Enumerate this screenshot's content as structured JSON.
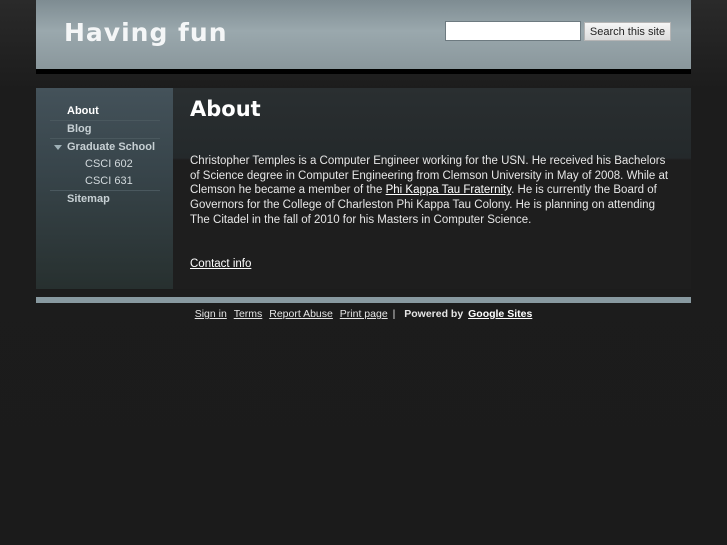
{
  "site": {
    "title": "Having fun"
  },
  "search": {
    "placeholder": "",
    "button_label": "Search this site"
  },
  "sidebar": {
    "items": [
      {
        "label": "About"
      },
      {
        "label": "Blog"
      },
      {
        "label": "Graduate School"
      },
      {
        "label": "CSCI 602"
      },
      {
        "label": "CSCI 631"
      },
      {
        "label": "Sitemap"
      }
    ]
  },
  "main": {
    "title": "About",
    "paragraph_part1": "Christopher Temples is a Computer Engineer working for the USN.   He received his Bachelors of Science degree in Computer Engineering from Clemson University in May of 2008.  While at Clemson he became a member of the ",
    "link_text": "Phi Kappa Tau Fraternity",
    "paragraph_part2": ".  He is currently the Board of Governors for the College of Charleston Phi Kappa Tau Colony.  He is planning on  attending The Citadel in the fall of 2010 for his Masters in Computer Science.",
    "contact_link": "Contact info"
  },
  "footer": {
    "sign_in": "Sign in",
    "terms": "Terms",
    "report_abuse": "Report Abuse",
    "print_page": "Print page",
    "separator": "|",
    "powered_by": "Powered by",
    "google_sites": "Google Sites"
  },
  "colors": {
    "header": "#9aa8ad",
    "sidebar": "#38454b",
    "background": "#1c1c1c",
    "footer_bar": "#8899a0"
  }
}
